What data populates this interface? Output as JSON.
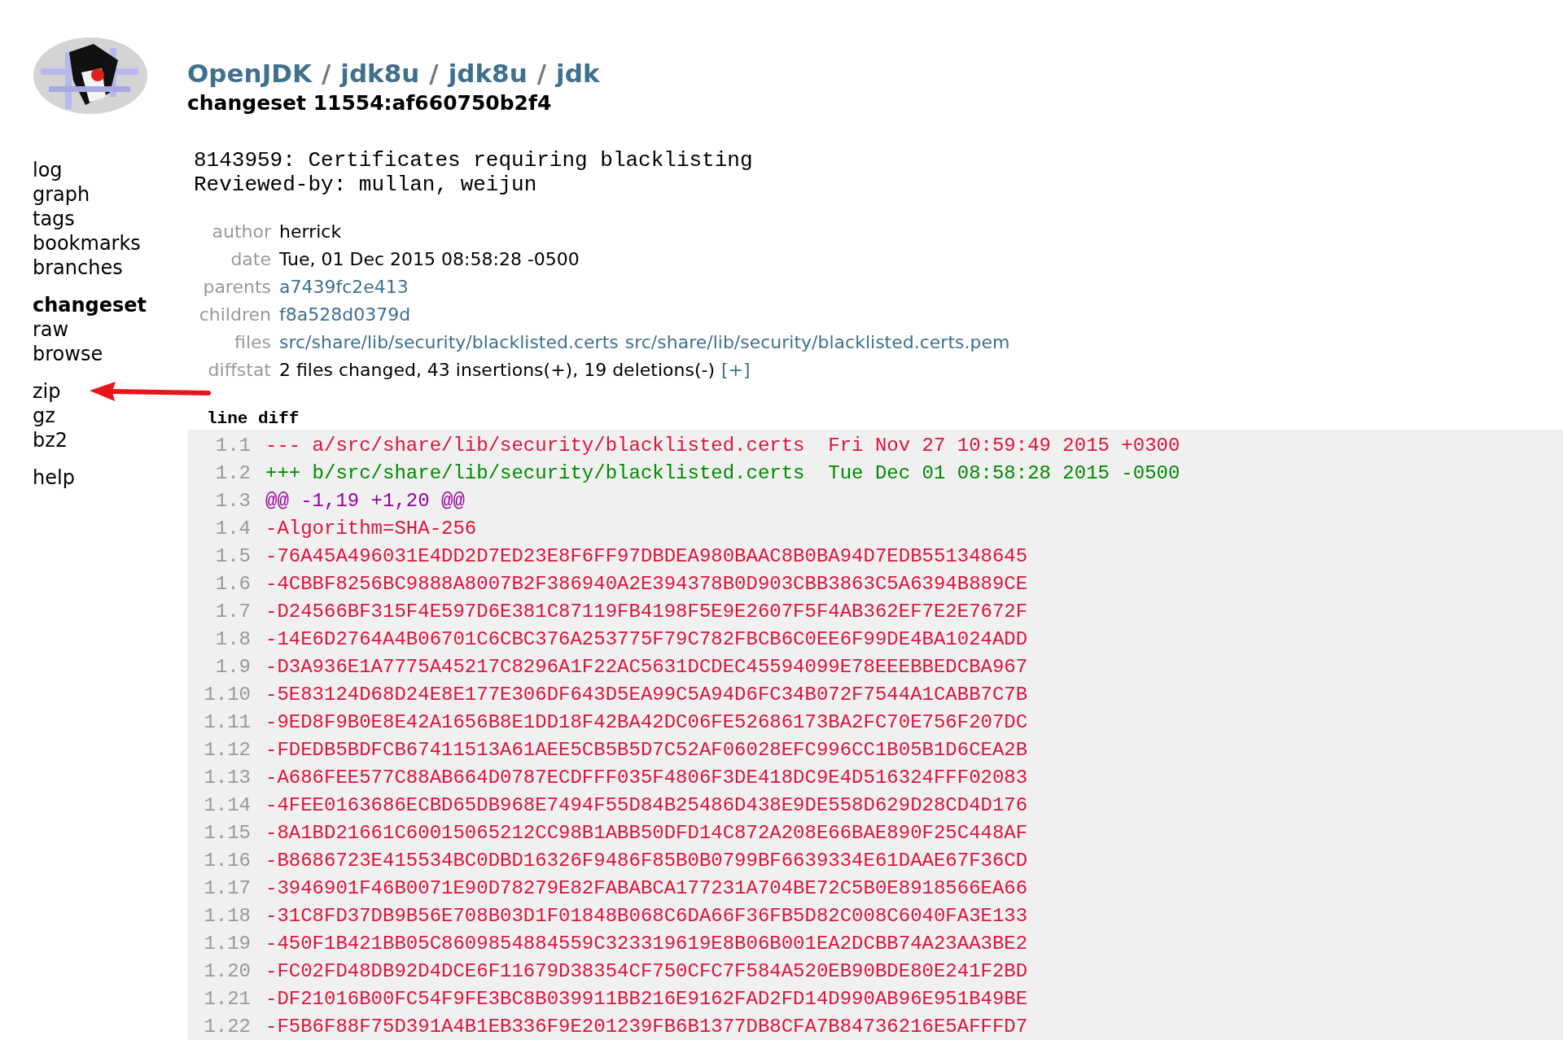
{
  "header": {
    "breadcrumb": [
      "OpenJDK",
      "jdk8u",
      "jdk8u",
      "jdk"
    ],
    "separator": "/",
    "subtitle": "changeset 11554:af660750b2f4"
  },
  "nav": [
    [
      {
        "label": "log",
        "selected": false
      },
      {
        "label": "graph",
        "selected": false
      },
      {
        "label": "tags",
        "selected": false
      },
      {
        "label": "bookmarks",
        "selected": false
      },
      {
        "label": "branches",
        "selected": false
      }
    ],
    [
      {
        "label": "changeset",
        "selected": true
      },
      {
        "label": "raw",
        "selected": false
      },
      {
        "label": "browse",
        "selected": false
      }
    ],
    [
      {
        "label": "zip",
        "selected": false
      },
      {
        "label": "gz",
        "selected": false
      },
      {
        "label": "bz2",
        "selected": false
      }
    ],
    [
      {
        "label": "help",
        "selected": false
      }
    ]
  ],
  "description": [
    "8143959: Certificates requiring blacklisting",
    "Reviewed-by: mullan, weijun"
  ],
  "metadata": [
    {
      "label": "author",
      "parts": [
        {
          "text": "herrick",
          "link": false
        }
      ]
    },
    {
      "label": "date",
      "parts": [
        {
          "text": "Tue, 01 Dec 2015 08:58:28 -0500",
          "link": false
        }
      ]
    },
    {
      "label": "parents",
      "parts": [
        {
          "text": "a7439fc2e413",
          "link": true
        }
      ]
    },
    {
      "label": "children",
      "parts": [
        {
          "text": "f8a528d0379d",
          "link": true
        }
      ]
    },
    {
      "label": "files",
      "parts": [
        {
          "text": "src/share/lib/security/blacklisted.certs",
          "link": true
        },
        {
          "text": "src/share/lib/security/blacklisted.certs.pem",
          "link": true
        }
      ]
    },
    {
      "label": "diffstat",
      "parts": [
        {
          "text": "2 files changed, 43 insertions(+), 19 deletions(-)",
          "link": false
        },
        {
          "text": "[+]",
          "link": true
        }
      ]
    }
  ],
  "diff": {
    "title": "line diff",
    "lines": [
      {
        "number": "1.1",
        "kind": "del",
        "text": "--- a/src/share/lib/security/blacklisted.certs  Fri Nov 27 10:59:49 2015 +0300"
      },
      {
        "number": "1.2",
        "kind": "add",
        "text": "+++ b/src/share/lib/security/blacklisted.certs  Tue Dec 01 08:58:28 2015 -0500"
      },
      {
        "number": "1.3",
        "kind": "hunk",
        "text": "@@ -1,19 +1,20 @@"
      },
      {
        "number": "1.4",
        "kind": "del",
        "text": "-Algorithm=SHA-256"
      },
      {
        "number": "1.5",
        "kind": "del",
        "text": "-76A45A496031E4DD2D7ED23E8F6FF97DBDEA980BAAC8B0BA94D7EDB551348645"
      },
      {
        "number": "1.6",
        "kind": "del",
        "text": "-4CBBF8256BC9888A8007B2F386940A2E394378B0D903CBB3863C5A6394B889CE"
      },
      {
        "number": "1.7",
        "kind": "del",
        "text": "-D24566BF315F4E597D6E381C87119FB4198F5E9E2607F5F4AB362EF7E2E7672F"
      },
      {
        "number": "1.8",
        "kind": "del",
        "text": "-14E6D2764A4B06701C6CBC376A253775F79C782FBCB6C0EE6F99DE4BA1024ADD"
      },
      {
        "number": "1.9",
        "kind": "del",
        "text": "-D3A936E1A7775A45217C8296A1F22AC5631DCDEC45594099E78EEEBBEDCBA967"
      },
      {
        "number": "1.10",
        "kind": "del",
        "text": "-5E83124D68D24E8E177E306DF643D5EA99C5A94D6FC34B072F7544A1CABB7C7B"
      },
      {
        "number": "1.11",
        "kind": "del",
        "text": "-9ED8F9B0E8E42A1656B8E1DD18F42BA42DC06FE52686173BA2FC70E756F207DC"
      },
      {
        "number": "1.12",
        "kind": "del",
        "text": "-FDEDB5BDFCB67411513A61AEE5CB5B5D7C52AF06028EFC996CC1B05B1D6CEA2B"
      },
      {
        "number": "1.13",
        "kind": "del",
        "text": "-A686FEE577C88AB664D0787ECDFFF035F4806F3DE418DC9E4D516324FFF02083"
      },
      {
        "number": "1.14",
        "kind": "del",
        "text": "-4FEE0163686ECBD65DB968E7494F55D84B25486D438E9DE558D629D28CD4D176"
      },
      {
        "number": "1.15",
        "kind": "del",
        "text": "-8A1BD21661C60015065212CC98B1ABB50DFD14C872A208E66BAE890F25C448AF"
      },
      {
        "number": "1.16",
        "kind": "del",
        "text": "-B8686723E415534BC0DBD16326F9486F85B0B0799BF6639334E61DAAE67F36CD"
      },
      {
        "number": "1.17",
        "kind": "del",
        "text": "-3946901F46B0071E90D78279E82FABABCA177231A704BE72C5B0E8918566EA66"
      },
      {
        "number": "1.18",
        "kind": "del",
        "text": "-31C8FD37DB9B56E708B03D1F01848B068C6DA66F36FB5D82C008C6040FA3E133"
      },
      {
        "number": "1.19",
        "kind": "del",
        "text": "-450F1B421BB05C8609854884559C323319619E8B06B001EA2DCBB74A23AA3BE2"
      },
      {
        "number": "1.20",
        "kind": "del",
        "text": "-FC02FD48DB92D4DCE6F11679D38354CF750CFC7F584A520EB90BDE80E241F2BD"
      },
      {
        "number": "1.21",
        "kind": "del",
        "text": "-DF21016B00FC54F9FE3BC8B039911BB216E9162FAD2FD14D990AB96E951B49BE"
      },
      {
        "number": "1.22",
        "kind": "del",
        "text": "-F5B6F88F75D391A4B1EB336F9E201239FB6B1377DB8CFA7B84736216E5AFFFD7"
      }
    ]
  }
}
